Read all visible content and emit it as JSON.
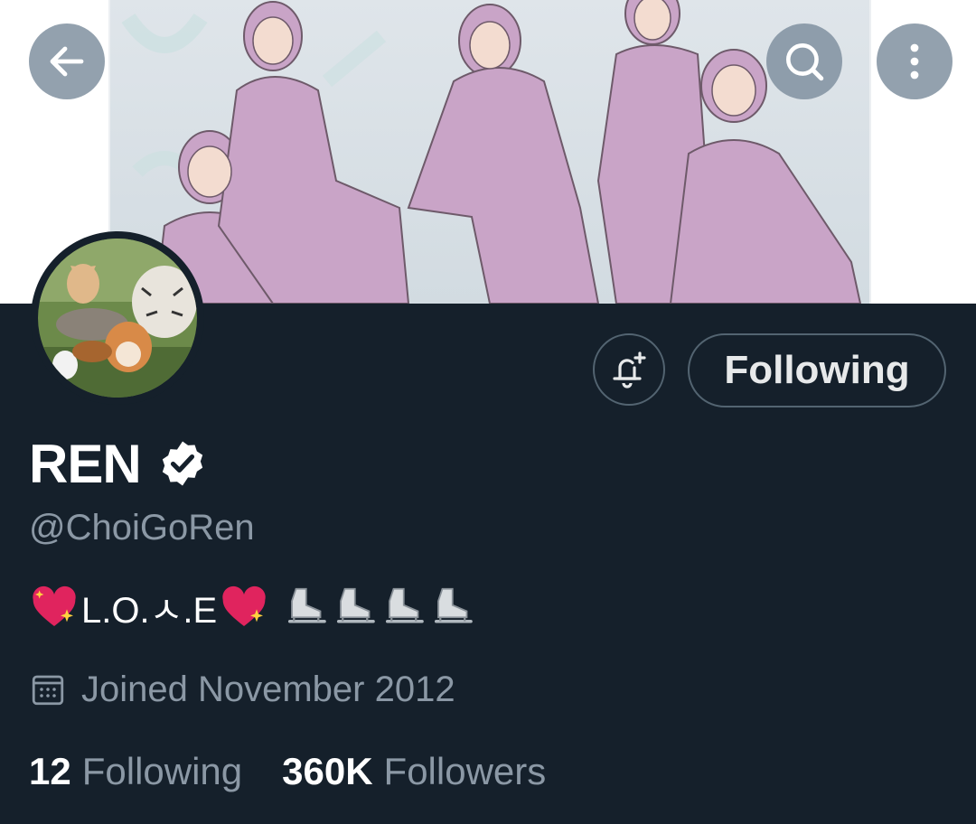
{
  "header": {
    "back_icon": "arrow-left-icon",
    "search_icon": "search-icon",
    "more_icon": "more-vertical-icon"
  },
  "banner": {
    "description_icon": "illustrated-group-banner",
    "colors": {
      "background": "#d6dee4",
      "accent": "#c9a4c7"
    }
  },
  "profile": {
    "display_name": "REN",
    "handle": "@ChoiGoRen",
    "verified_icon": "verified-badge-icon",
    "bio_text": "L.O.ㅅ.E",
    "bio_emoji": [
      "sparkling-heart",
      "sparkling-heart",
      "ice-skate",
      "ice-skate",
      "ice-skate",
      "ice-skate"
    ],
    "joined": "Joined November 2012",
    "joined_icon": "calendar-icon"
  },
  "actions": {
    "notify_icon": "bell-plus-icon",
    "following_label": "Following"
  },
  "stats": {
    "following_count": "12",
    "following_label": "Following",
    "followers_count": "360K",
    "followers_label": "Followers"
  },
  "colors": {
    "background": "#15202b",
    "muted_text": "#8b98a5",
    "border": "#536471",
    "nav_button": "#8090a0"
  }
}
